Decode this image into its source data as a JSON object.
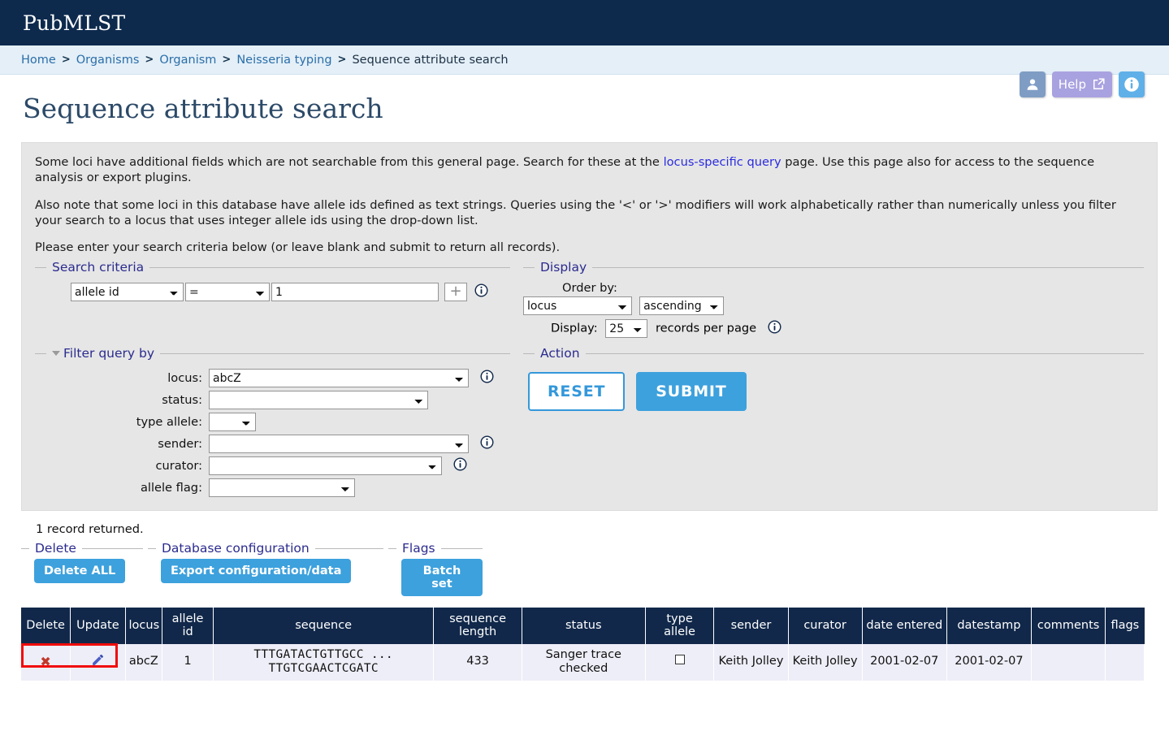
{
  "brand": "PubMLST",
  "breadcrumb": {
    "items": [
      {
        "label": "Home",
        "link": true
      },
      {
        "label": "Organisms",
        "link": true
      },
      {
        "label": "Organism",
        "link": true
      },
      {
        "label": "Neisseria typing",
        "link": true
      },
      {
        "label": "Sequence attribute search",
        "link": false
      }
    ],
    "separator": ">"
  },
  "header_tools": {
    "user_icon": "user-icon",
    "help_label": "Help",
    "help_icon": "external-link-icon",
    "info_icon": "info-icon",
    "colors": {
      "user": "#7f9dc4",
      "help": "#a9a2e0",
      "info": "#5fb0e8"
    }
  },
  "page_title": "Sequence attribute search",
  "intro": {
    "p1_before": "Some loci have additional fields which are not searchable from this general page. Search for these at the ",
    "p1_link": "locus-specific query",
    "p1_after": " page. Use this page also for access to the sequence analysis or export plugins.",
    "p2": "Also note that some loci in this database have allele ids defined as text strings. Queries using the '<' or '>' modifiers will work alphabetically rather than numerically unless you filter your search to a locus that uses integer allele ids using the drop-down list.",
    "p3": "Please enter your search criteria below (or leave blank and submit to return all records)."
  },
  "search_criteria": {
    "legend": "Search criteria",
    "field_value": "allele id",
    "operator_value": "=",
    "value": "1",
    "value_placeholder": "",
    "add_button": "+",
    "info_icon": "info-icon"
  },
  "display": {
    "legend": "Display",
    "order_by_label": "Order by:",
    "order_by_value": "locus",
    "direction_value": "ascending",
    "display_label": "Display:",
    "records_value": "25",
    "records_suffix": "records per page",
    "info_icon": "info-icon"
  },
  "filter": {
    "legend": "Filter query by",
    "rows": [
      {
        "label": "locus:",
        "value": "abcZ",
        "info": true
      },
      {
        "label": "status:",
        "value": "",
        "info": false
      },
      {
        "label": "type allele:",
        "value": "",
        "info": false
      },
      {
        "label": "sender:",
        "value": "",
        "info": true
      },
      {
        "label": "curator:",
        "value": "",
        "info": true
      },
      {
        "label": "allele flag:",
        "value": "",
        "info": false
      }
    ]
  },
  "action": {
    "legend": "Action",
    "reset_label": "RESET",
    "submit_label": "SUBMIT",
    "submit_color": "#3da1dd"
  },
  "results": {
    "record_count": "1 record returned.",
    "toolbars": [
      {
        "legend": "Delete",
        "button": "Delete ALL"
      },
      {
        "legend": "Database configuration",
        "button": "Export configuration/data"
      },
      {
        "legend": "Flags",
        "button": "Batch set"
      }
    ],
    "columns": [
      "Delete",
      "Update",
      "locus",
      "allele id",
      "sequence",
      "sequence length",
      "status",
      "type allele",
      "sender",
      "curator",
      "date entered",
      "datestamp",
      "comments",
      "flags"
    ],
    "rows": [
      {
        "delete_icon": "cross-icon",
        "update_icon": "pencil-icon",
        "locus": "abcZ",
        "allele_id": "1",
        "sequence": "TTTGATACTGTTGCC ...\nTTGTCGAACTCGATC",
        "sequence_length": "433",
        "status": "Sanger trace checked",
        "type_allele": "unchecked-checkbox",
        "sender": "Keith Jolley",
        "curator": "Keith Jolley",
        "date_entered": "2001-02-07",
        "datestamp": "2001-02-07",
        "comments": "",
        "flags": ""
      }
    ],
    "annotation_color": "#f00b0b"
  }
}
